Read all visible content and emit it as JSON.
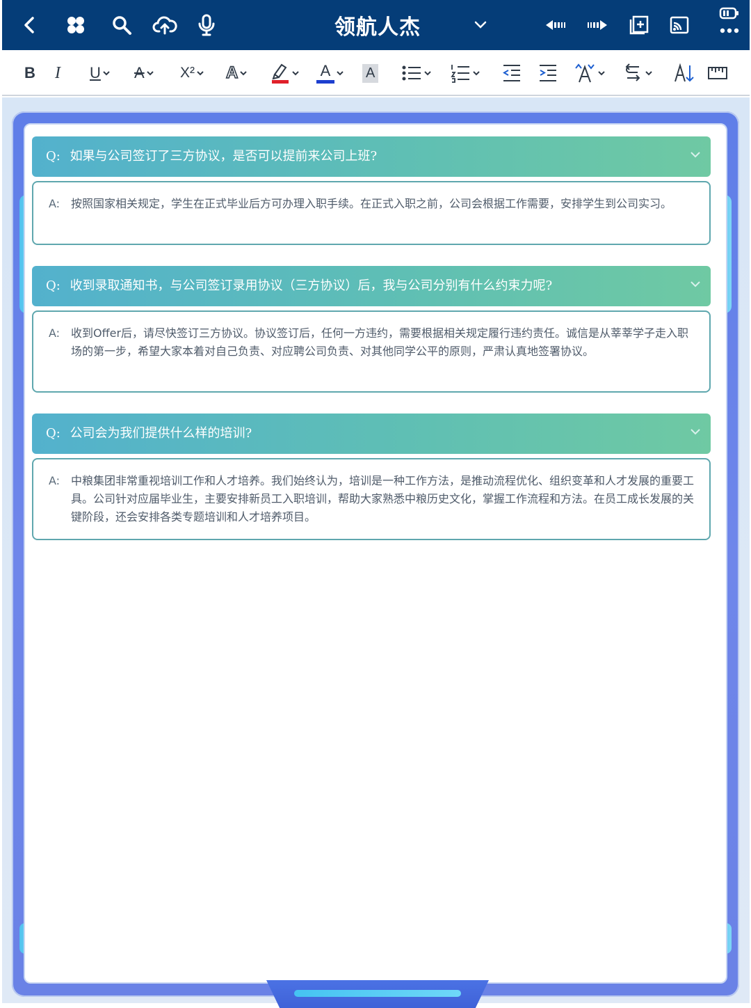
{
  "appbar": {
    "title": "领航人杰",
    "icons": [
      "back-icon",
      "apps-icon",
      "search-icon",
      "cloud-upload-icon",
      "microphone-icon",
      "chevron-down-icon",
      "rewind-icon",
      "forward-icon",
      "add-page-icon",
      "cast-icon",
      "battery-icon",
      "more-icon"
    ]
  },
  "toolbar": {
    "bold": "B",
    "italic": "I",
    "underline": "U",
    "strike": "A",
    "superscript": "X²",
    "text_effect": "A",
    "highlight_color": "#e0202a",
    "font_color": "A",
    "font_color_value": "#1d3fcf",
    "char_shading": "A",
    "icons": [
      "bullet-list-icon",
      "numbered-list-icon",
      "outdent-icon",
      "indent-icon",
      "font-size-icon",
      "direction-icon",
      "sort-icon",
      "ruler-icon"
    ]
  },
  "faq": {
    "q_prefix": "Q:",
    "a_prefix": "A:",
    "items": [
      {
        "question": "如果与公司签订了三方协议，是否可以提前来公司上班?",
        "answer": "按照国家相关规定，学生在正式毕业后方可办理入职手续。在正式入职之前，公司会根据工作需要，安排学生到公司实习。"
      },
      {
        "question": "收到录取通知书，与公司签订录用协议（三方协议）后，我与公司分别有什么约束力呢?",
        "answer": "收到Offer后，请尽快签订三方协议。协议签订后，任何一方违约，需要根据相关规定履行违约责任。诚信是从莘莘学子走入职场的第一步，希望大家本着对自己负责、对应聘公司负责、对其他同学公平的原则，严肃认真地签署协议。"
      },
      {
        "question": "公司会为我们提供什么样的培训?",
        "answer": "中粮集团非常重视培训工作和人才培养。我们始终认为，培训是一种工作方法，是推动流程优化、组织变革和人才发展的重要工具。公司针对应届毕业生，主要安排新员工入职培训，帮助大家熟悉中粮历史文化，掌握工作流程和方法。在员工成长发展的关键阶段，还会安排各类专题培训和人才培养项目。"
      }
    ]
  }
}
